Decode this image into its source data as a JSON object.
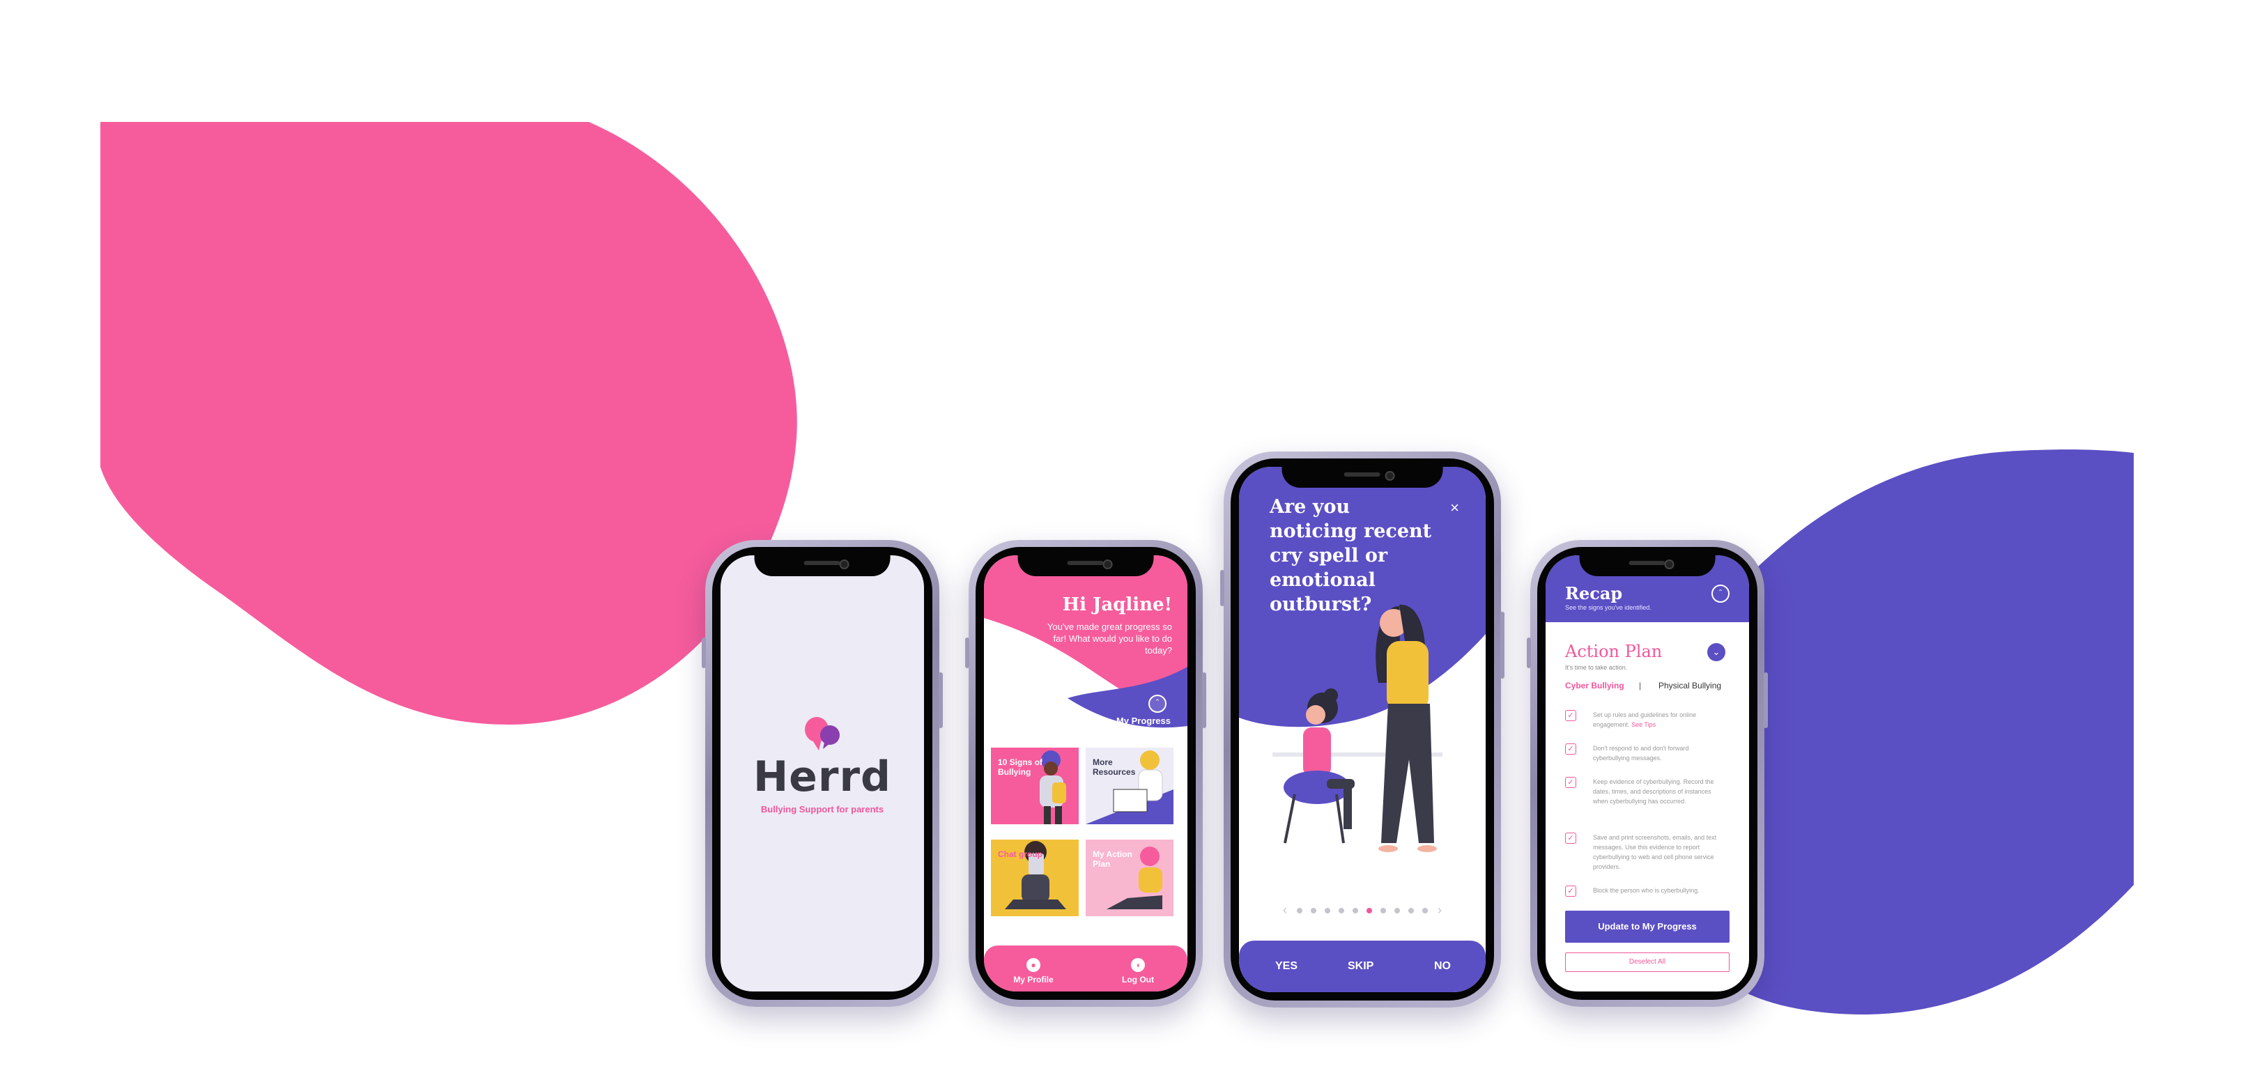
{
  "colors": {
    "pink": "#f65c9c",
    "purple": "#5b4fc4",
    "lavender": "#ecebf6",
    "yellow": "#f2c13a"
  },
  "splash": {
    "app_name": "Herrd",
    "tagline": "Bullying Support for parents"
  },
  "home": {
    "greeting": "Hi  Jaqline!",
    "subtitle": "You've made great progress so far!  What would you like to do today?",
    "progress_label": "My Progress",
    "tiles": [
      {
        "label": "10 Signs of Bullying"
      },
      {
        "label": "More Resources"
      },
      {
        "label": "Chat group"
      },
      {
        "label": "My Action Plan"
      }
    ],
    "nav": [
      {
        "label": "My Profile",
        "icon": "user-icon"
      },
      {
        "label": "Log Out",
        "icon": "logout-icon"
      }
    ]
  },
  "question": {
    "title": "Are you noticing recent cry spell or emotional outburst?",
    "close_icon": "close-icon",
    "dots_total": 10,
    "dots_active": 5,
    "answers": {
      "yes": "YES",
      "skip": "SKIP",
      "no": "NO"
    }
  },
  "recap": {
    "title": "Recap",
    "subtitle": "See the signs you've identified.",
    "action_plan_title": "Action Plan",
    "action_plan_sub": "It's time to take action.",
    "tab_cyber": "Cyber Bullying",
    "tab_separator": "|",
    "tab_physical": "Physical Bullying",
    "items": [
      {
        "text": "Set up rules and guidelines for online engagement.",
        "link": "See Tips"
      },
      {
        "text": "Don't respond to and don't forward cyberbullying messages.",
        "link": ""
      },
      {
        "text": "Keep evidence of cyberbullying. Record the dates, times, and descriptions of instances when cyberbullying has occurred.",
        "link": ""
      },
      {
        "text": "Save and print screenshots, emails, and text messages. Use this evidence to report cyberbullying to web and cell phone service providers.",
        "link": ""
      },
      {
        "text": "Block the person who is cyberbullying.",
        "link": ""
      }
    ],
    "update_button": "Update to My Progress",
    "deselect_button": "Deselect All"
  }
}
